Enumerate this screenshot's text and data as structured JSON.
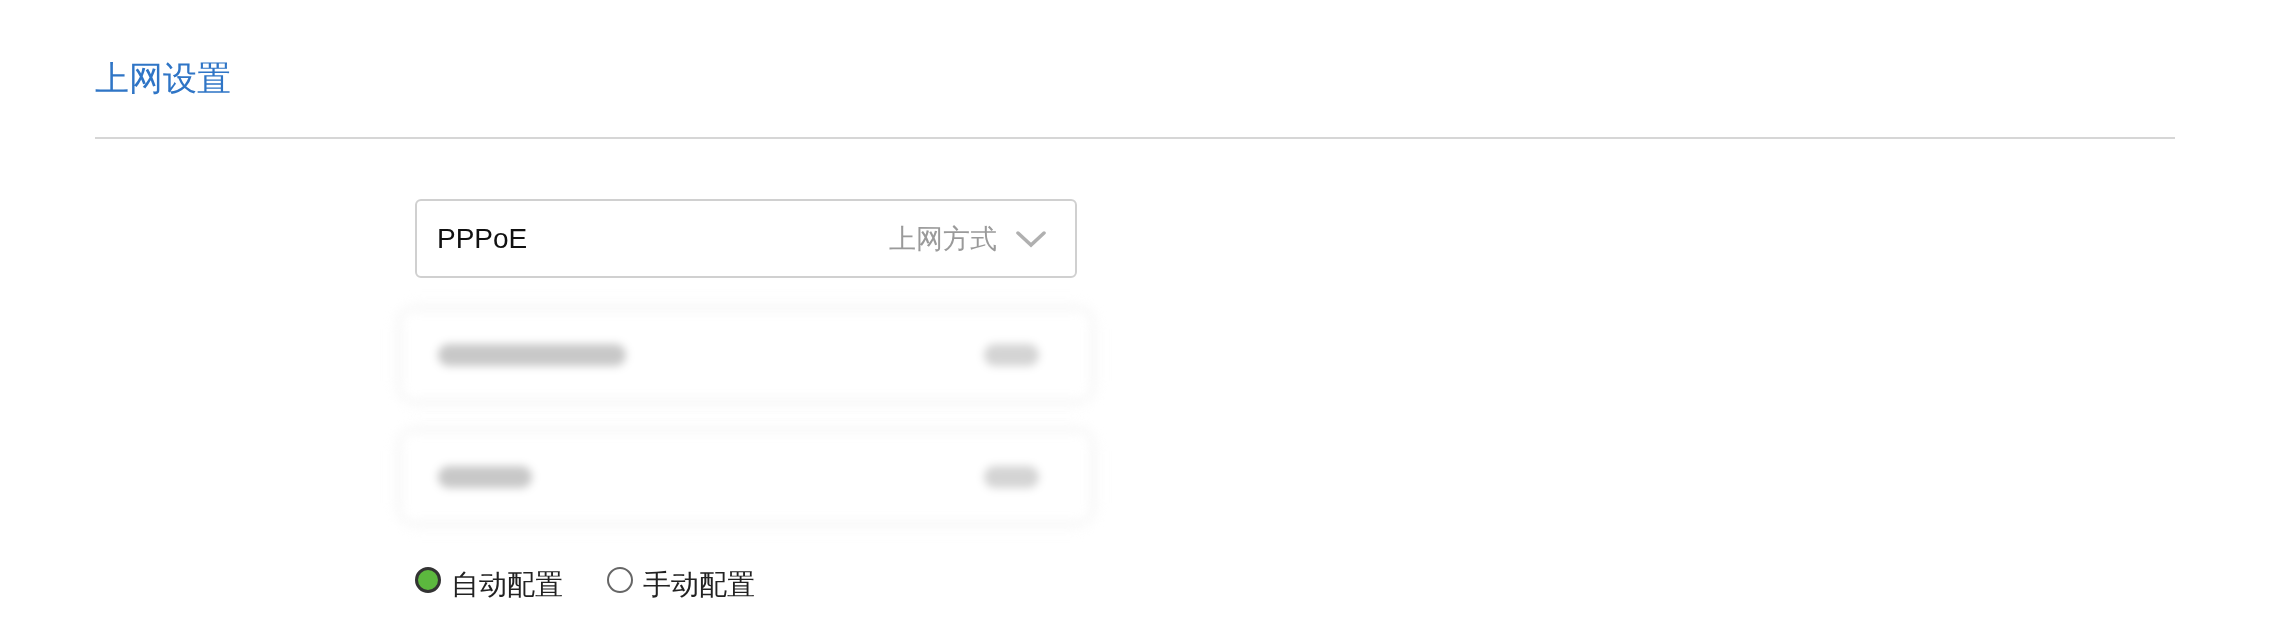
{
  "page_title": "上网设置",
  "connection_select": {
    "value": "PPPoE",
    "placeholder": "上网方式"
  },
  "config_mode": [
    {
      "label": "自动配置",
      "selected": true
    },
    {
      "label": "手动配置",
      "selected": false
    }
  ]
}
